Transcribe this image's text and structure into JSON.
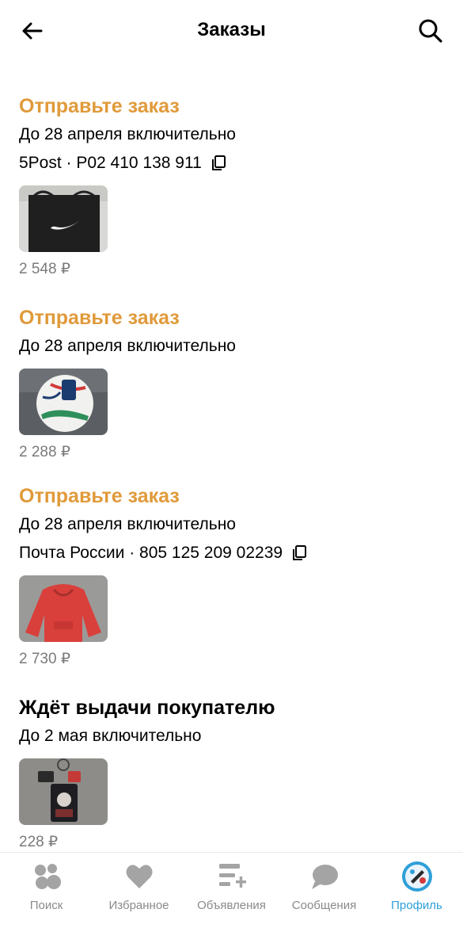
{
  "header": {
    "title": "Заказы"
  },
  "orders": [
    {
      "status": "Отправьте заказ",
      "deadline": "До 28 апреля включительно",
      "tracking": "5Post · P02 410 138 911",
      "image": "black-nike-bag",
      "price": "2 548 ₽"
    },
    {
      "status": "Отправьте заказ",
      "deadline": "До 28 апреля включительно",
      "image": "soccer-ball",
      "price": "2 288 ₽"
    },
    {
      "status": "Отправьте заказ",
      "deadline": "До 28 апреля включительно",
      "tracking": "Почта России · 805 125 209 02239",
      "image": "red-hoodie",
      "price": "2 730 ₽"
    },
    {
      "status": "Ждёт выдачи покупателю",
      "deadline": "До 2 мая включительно",
      "image": "keychain",
      "price": "228 ₽"
    }
  ],
  "nav": {
    "items": [
      {
        "label": "Поиск",
        "icon": "search-circles-icon"
      },
      {
        "label": "Избранное",
        "icon": "heart-icon"
      },
      {
        "label": "Объявления",
        "icon": "ads-icon"
      },
      {
        "label": "Сообщения",
        "icon": "chat-icon"
      },
      {
        "label": "Профиль",
        "icon": "avatar-icon"
      }
    ],
    "active_index": 4
  },
  "colors": {
    "action_status": "#e09a3a",
    "active_nav": "#2d9fd8",
    "inactive_nav": "#8a8a8a",
    "price": "#7a7a7a"
  }
}
